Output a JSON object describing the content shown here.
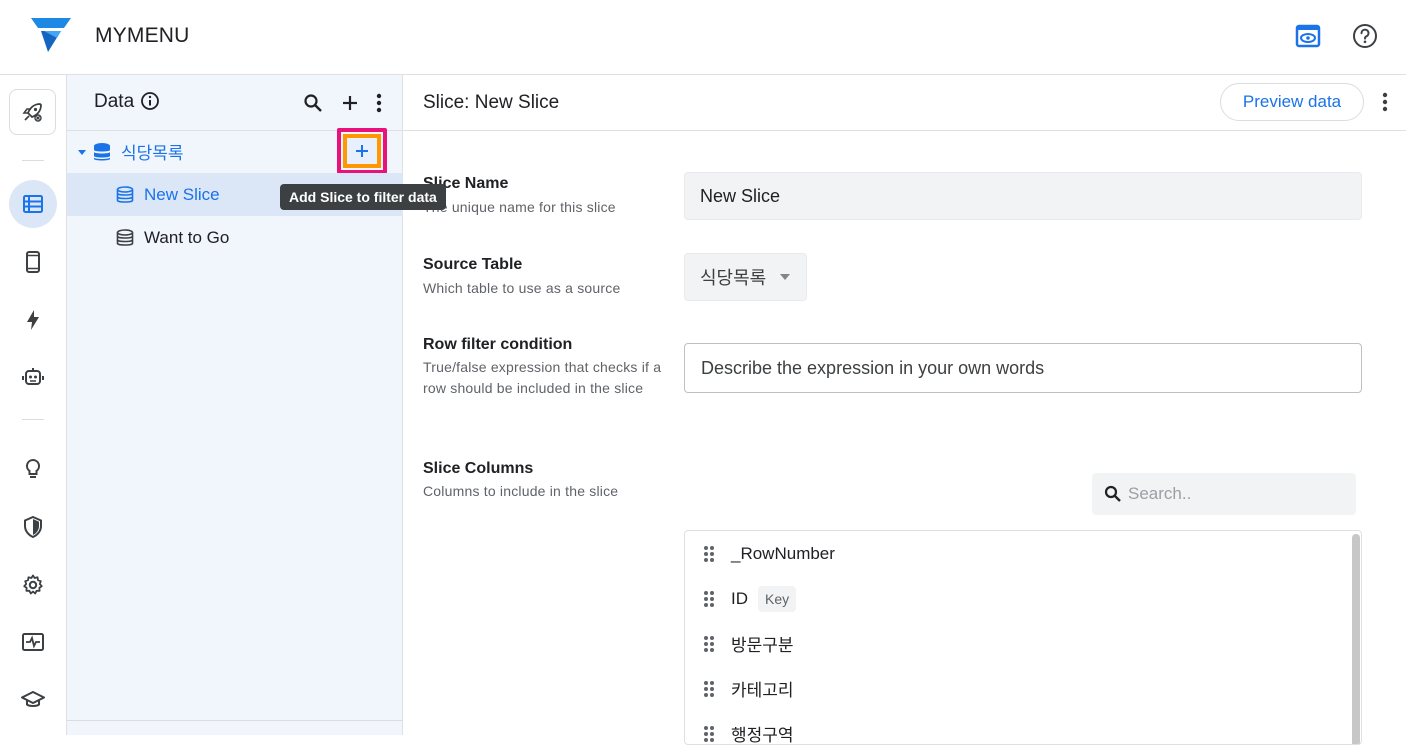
{
  "app": {
    "title": "MYMENU"
  },
  "data_panel": {
    "title": "Data",
    "tree": {
      "table": {
        "label": "식당목록"
      },
      "slices": [
        {
          "label": "New Slice",
          "selected": true
        },
        {
          "label": "Want to Go",
          "selected": false
        }
      ]
    },
    "tooltip": "Add Slice to filter data"
  },
  "main": {
    "title": "Slice: New Slice",
    "preview_label": "Preview data",
    "fields": {
      "slice_name": {
        "label": "Slice Name",
        "help": "The unique name for this slice",
        "value": "New Slice"
      },
      "source_table": {
        "label": "Source Table",
        "help": "Which table to use as a source",
        "value": "식당목록"
      },
      "row_filter": {
        "label": "Row filter condition",
        "help": "True/false expression that checks if a row should be included in the slice",
        "placeholder": "Describe the expression in your own words"
      },
      "slice_columns": {
        "label": "Slice Columns",
        "help": "Columns to include in the slice",
        "search_placeholder": "Search..",
        "columns": [
          {
            "name": "_RowNumber",
            "badge": ""
          },
          {
            "name": "ID",
            "badge": "Key"
          },
          {
            "name": "방문구분",
            "badge": ""
          },
          {
            "name": "카테고리",
            "badge": ""
          },
          {
            "name": "행정구역",
            "badge": ""
          }
        ]
      }
    }
  },
  "colors": {
    "accent": "#1a73e8",
    "highlight_pink": "#e8127a",
    "highlight_orange": "#ff9800",
    "panel_bg": "#f1f5fc",
    "selected_bg": "#dbe6f7"
  }
}
